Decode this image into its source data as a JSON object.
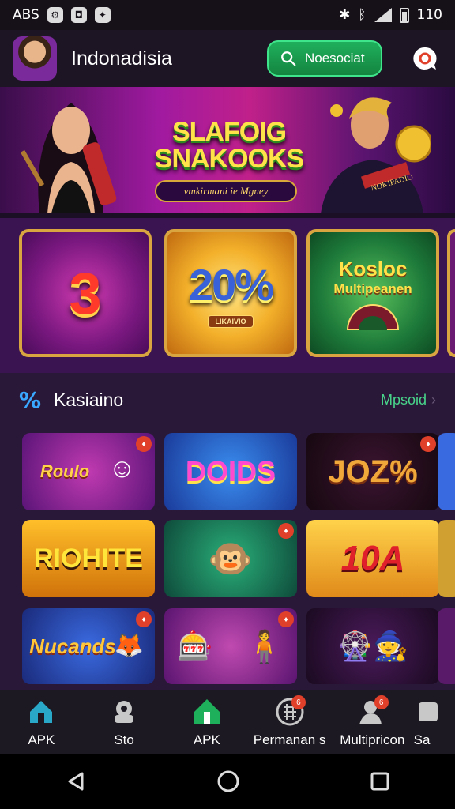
{
  "status_bar": {
    "left_text": "ABS",
    "time": "110"
  },
  "header": {
    "brand": "Indonadisia",
    "search_label": "Noesociat"
  },
  "banner": {
    "title_line1": "SLAFOIG",
    "title_line2": "SNAKOOKS",
    "subtitle": "vmkirmani ie Mgney",
    "ribbon": "NOKIPADIO"
  },
  "promos": [
    {
      "text": "3"
    },
    {
      "text": "20%",
      "tag": "LIKAIVIO"
    },
    {
      "line1": "Kosloc",
      "line2": "Multipeanen"
    }
  ],
  "section": {
    "title": "Kasiaino",
    "more_label": "Mpsoid"
  },
  "games": [
    {
      "label": "Roulo"
    },
    {
      "label": "DOIDS"
    },
    {
      "label": "JOZ%"
    },
    {
      "label": "RIOHITE"
    },
    {
      "label": ""
    },
    {
      "label": "10A"
    },
    {
      "label": "Nucands"
    },
    {
      "label": ""
    },
    {
      "label": ""
    }
  ],
  "bottom_nav": [
    {
      "label": "APK"
    },
    {
      "label": "Sto"
    },
    {
      "label": "APK"
    },
    {
      "label": "Permanan s"
    },
    {
      "label": "Multipricon"
    },
    {
      "label": "Sa"
    }
  ],
  "colors": {
    "accent_green": "#1fb05c",
    "gold": "#d8a540",
    "purple": "#3a1450"
  }
}
